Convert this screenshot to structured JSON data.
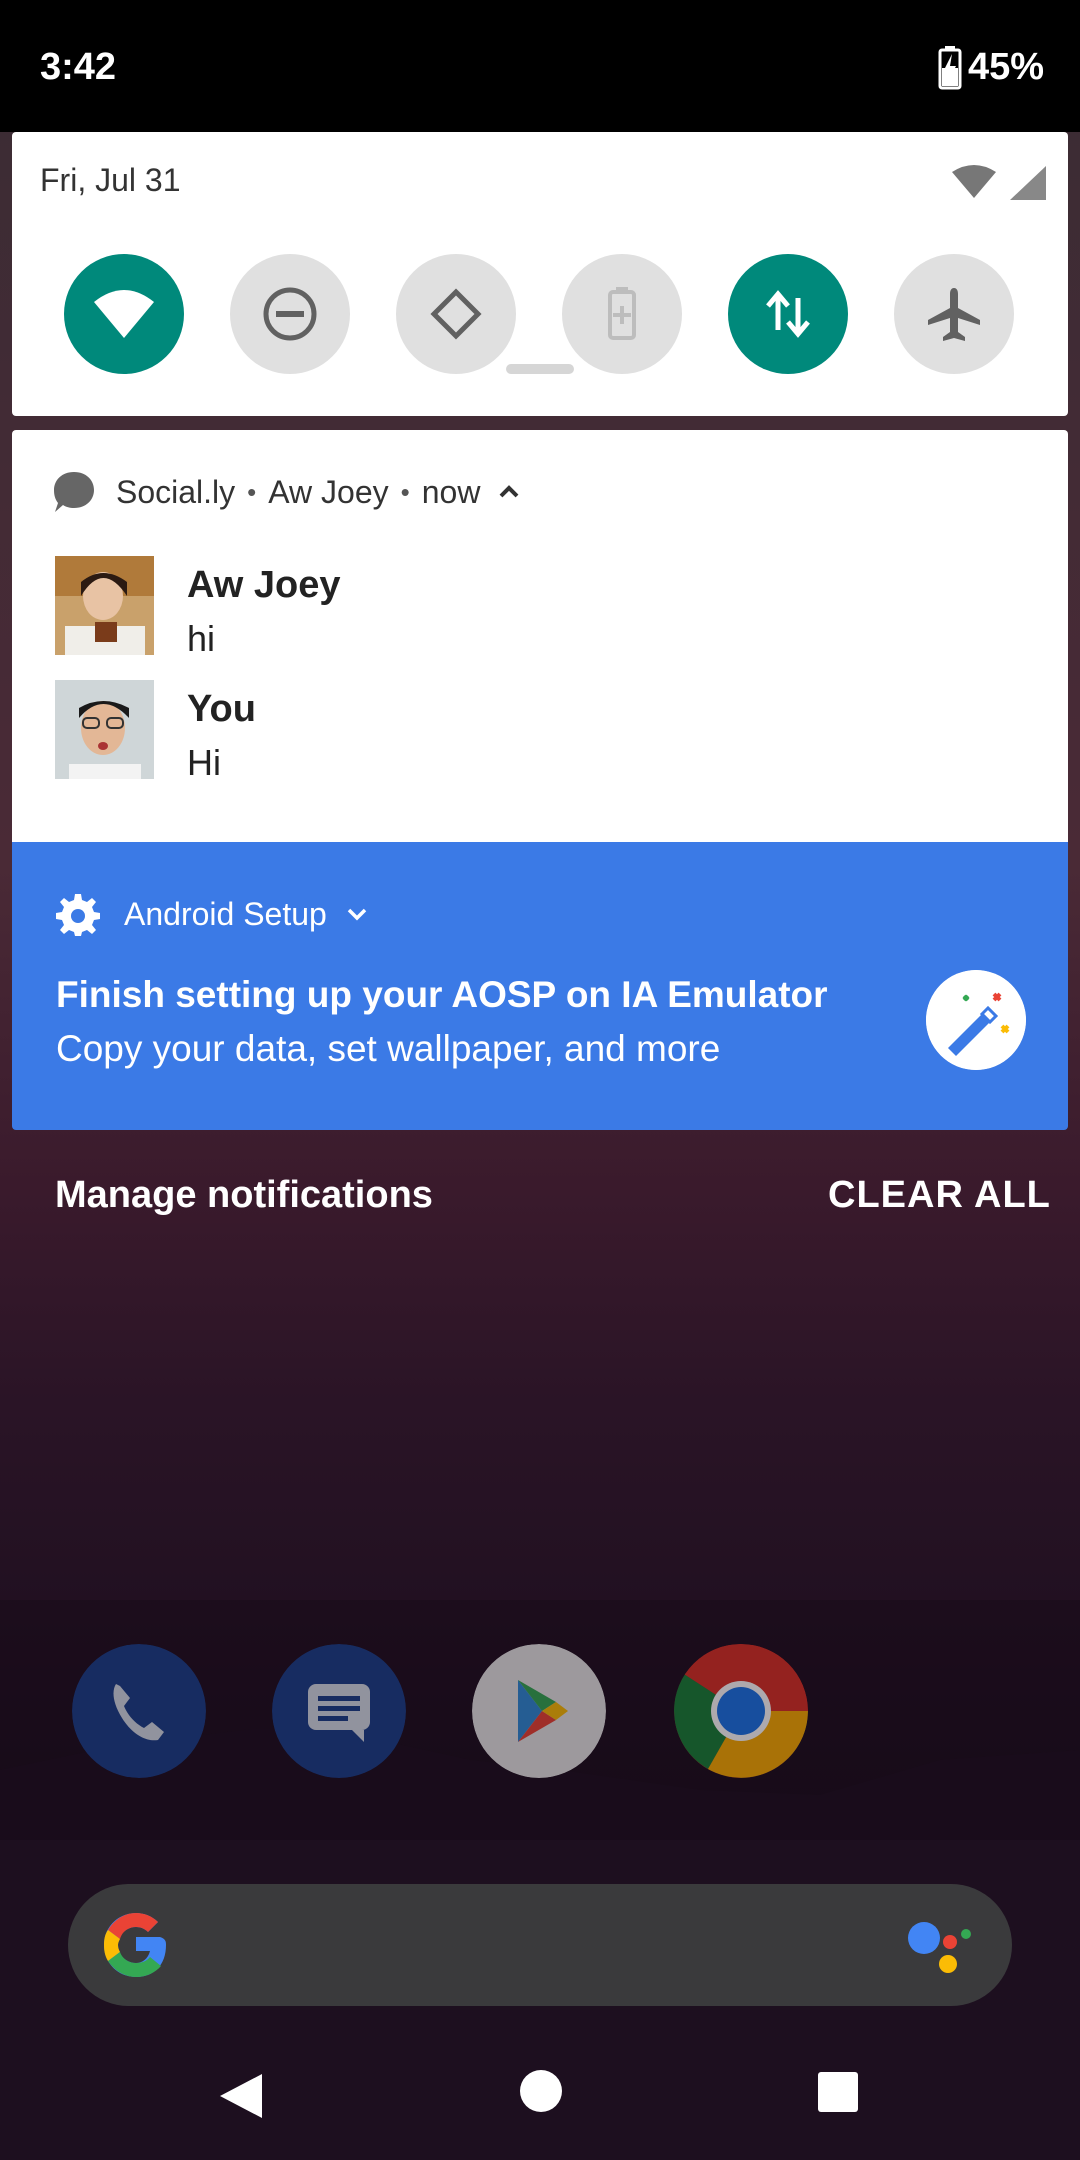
{
  "status_bar": {
    "time": "3:42",
    "battery": "45%"
  },
  "quick_settings": {
    "date": "Fri, Jul 31",
    "tiles": [
      {
        "name": "wifi",
        "state": "on"
      },
      {
        "name": "do-not-disturb",
        "state": "off"
      },
      {
        "name": "auto-rotate",
        "state": "off"
      },
      {
        "name": "battery-saver",
        "state": "disabled"
      },
      {
        "name": "mobile-data",
        "state": "on"
      },
      {
        "name": "airplane-mode",
        "state": "off"
      }
    ],
    "accent_color": "#00897b"
  },
  "message_notification": {
    "app": "Social.ly",
    "conversation": "Aw Joey",
    "time": "now",
    "messages": [
      {
        "sender": "Aw Joey",
        "text": "hi"
      },
      {
        "sender": "You",
        "text": "Hi"
      }
    ]
  },
  "setup_notification": {
    "app": "Android Setup",
    "title": "Finish setting up your AOSP on IA Emulator",
    "subtitle": "Copy your data, set wallpaper, and more",
    "color": "#3b7ae6"
  },
  "actions": {
    "manage": "Manage notifications",
    "clear_all": "CLEAR ALL"
  },
  "dock": [
    "phone-icon",
    "messages-icon",
    "play-store-icon",
    "chrome-icon"
  ]
}
